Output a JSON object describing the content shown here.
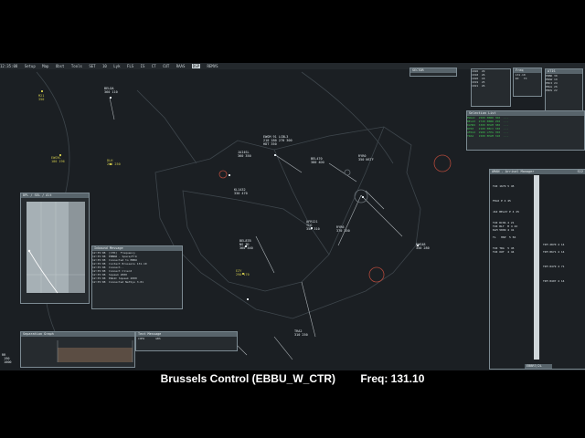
{
  "window": {
    "caption_left": "Brussels Control (EBBU_W_CTR)",
    "caption_right": "Freq: 131.10"
  },
  "menubar": {
    "items": [
      "12:35:08",
      "Setup",
      "Map",
      "Obst",
      "Tools",
      "SET",
      "10",
      "Lyk",
      "FLS",
      "IS",
      "CT",
      "CUT",
      "RAAS",
      "DSP",
      "REMVS"
    ],
    "selected": "DSP"
  },
  "windows": {
    "sel_list_title": "Selection List",
    "actd_title": "Inbound Message",
    "chat_title": "Text Message",
    "chat_lines": [
      "COM1",
      "",
      "GBS"
    ],
    "aml_title": "AMAN - Arrival Manager",
    "aml_header": "S12",
    "aml_bottom": "EBBR7/2L",
    "plot_title": "DPL / SEL / Alt",
    "plot2_title": "Separation Graph"
  },
  "colors": {
    "scope_bg": "#1b1f23",
    "caption_text": "#ffffff",
    "aircraft_tag": "#dfe6ea",
    "uncontrolled_tag": "#c8c24a",
    "list_green": "#3fc04f"
  }
}
